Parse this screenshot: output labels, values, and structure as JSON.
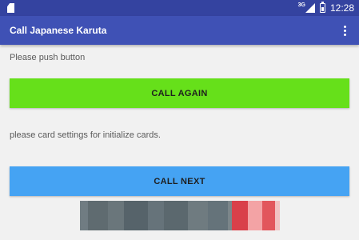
{
  "status_bar": {
    "network_type": "3G",
    "time": "12:28"
  },
  "app_bar": {
    "title": "Call Japanese Karuta",
    "menu_icon": "overflow-menu-icon"
  },
  "main": {
    "instruction_top": "Please push button",
    "call_again_label": "CALL AGAIN",
    "instruction_bottom": "please card settings for initialize cards.",
    "call_next_label": "CALL NEXT"
  },
  "colors": {
    "status_bar": "#3443a0",
    "app_bar": "#3f51b5",
    "call_again": "#66e01a",
    "call_next": "#45a3f3",
    "background": "#f1f1f1"
  }
}
